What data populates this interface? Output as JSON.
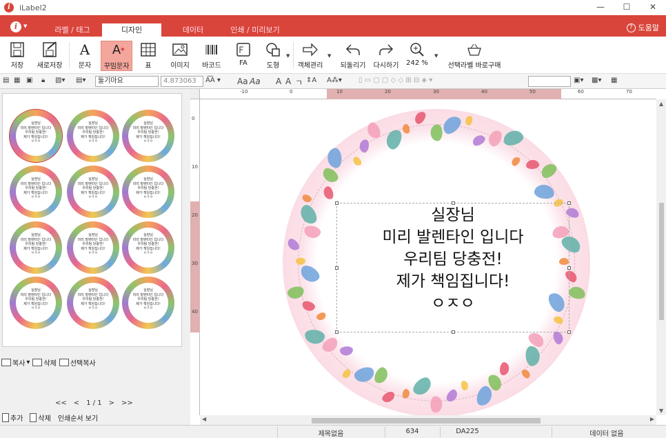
{
  "window": {
    "title": "iLabel2",
    "minimize": "—",
    "maximize": "☐",
    "close": "✕"
  },
  "menu": {
    "logo": "i",
    "tabs": [
      {
        "label": "라벨 / 태그"
      },
      {
        "label": "디자인"
      },
      {
        "label": "데이터"
      },
      {
        "label": "인쇄 / 미리보기"
      }
    ],
    "help": "도움말",
    "help_icon": "?"
  },
  "ribbon": {
    "save": "저장",
    "save_as": "새로저장",
    "text": "문자",
    "fancy_text": "꾸밈문자",
    "table": "표",
    "image": "이미지",
    "barcode": "바코드",
    "fa": "FA",
    "shape": "도형",
    "object_manage": "객체관리",
    "undo": "되돌리기",
    "redo": "다시하기",
    "zoom": "242 %",
    "buy_label": "선택라벨 바로구매"
  },
  "format": {
    "font": "둘기마요",
    "font_size": "4.873063"
  },
  "thumbnails": {
    "lines": [
      "실장님",
      "미리 발렌타인 입니다",
      "우리팀 당충전!",
      "제가 책임집니다!",
      "ㅇㅈㅇ"
    ]
  },
  "left_actions": {
    "copy": "복사",
    "delete": "삭제",
    "select_copy": "선택복사",
    "first": "<<",
    "prev": "<",
    "page": "1 / 1",
    "next": ">",
    "last": ">>",
    "add": "추가",
    "remove": "삭제",
    "print_order": "인쇄순서 보기"
  },
  "canvas": {
    "lines": [
      "실장님",
      "미리 발렌타인 입니다",
      "우리팀 당충전!",
      "제가 책임집니다!",
      "ㅇㅈㅇ"
    ],
    "ruler_top": [
      "-10",
      "0",
      "10",
      "20",
      "30",
      "40",
      "50",
      "60",
      "70"
    ],
    "ruler_left": [
      "0",
      "10",
      "20",
      "30",
      "40"
    ]
  },
  "status": {
    "title": "제목없음",
    "code": "634",
    "model": "DA225",
    "data": "데이터 없음"
  }
}
